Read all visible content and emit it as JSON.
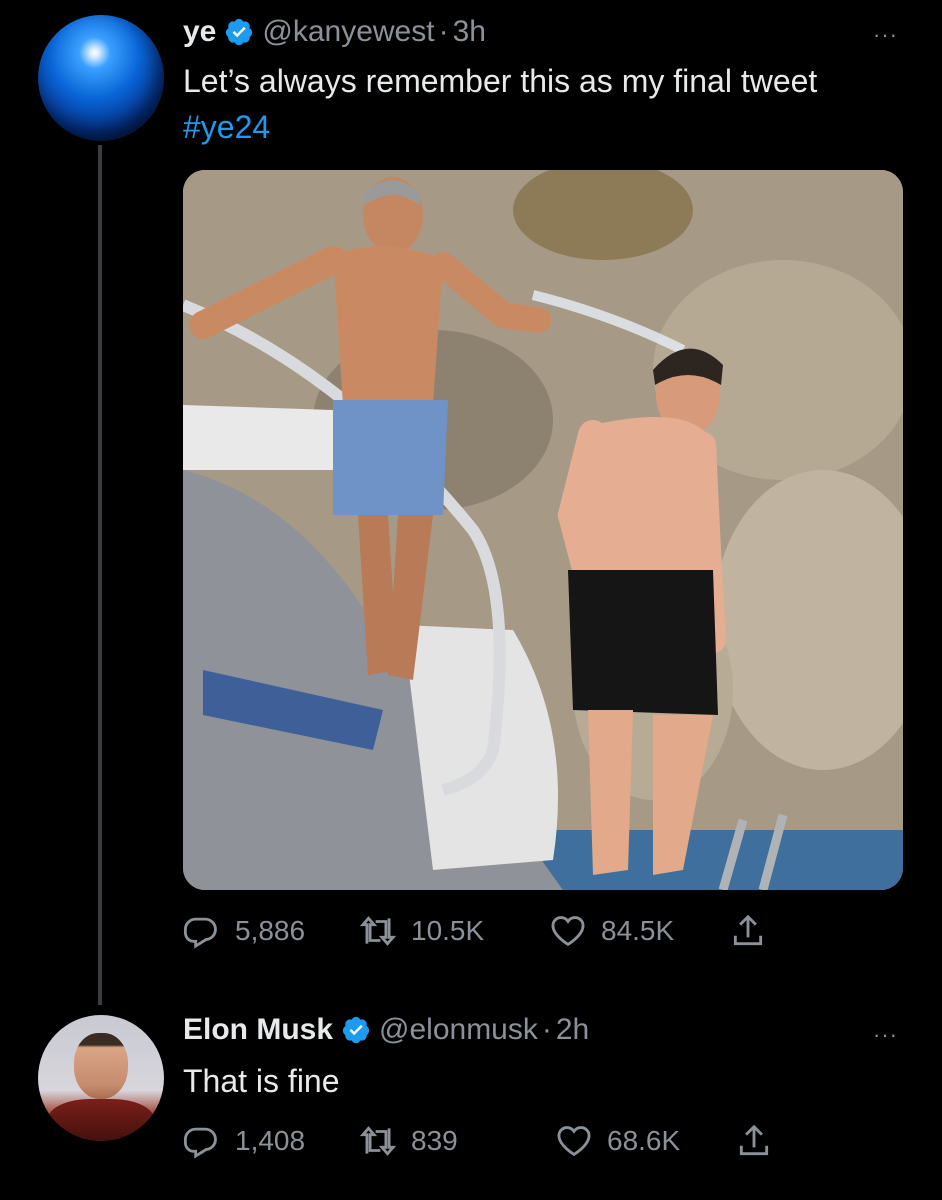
{
  "tweets": [
    {
      "name": "ye",
      "handle": "@kanyewest",
      "separator": "·",
      "time": "3h",
      "text_main": "Let’s always remember this as my final tweet ",
      "hashtag": "#ye24",
      "more_label": "···",
      "has_media": true,
      "stats": {
        "replies": "5,886",
        "retweets": "10.5K",
        "likes": "84.5K"
      },
      "icons": {
        "reply": "reply-icon",
        "retweet": "retweet-icon",
        "like": "heart-icon",
        "share": "share-icon",
        "verified": "verified-badge-icon"
      }
    },
    {
      "name": "Elon Musk",
      "handle": "@elonmusk",
      "separator": "·",
      "time": "2h",
      "text_main": "That is fine",
      "more_label": "···",
      "stats": {
        "replies": "1,408",
        "retweets": "839",
        "likes": "68.6K"
      }
    }
  ],
  "colors": {
    "background": "#000000",
    "text": "#e7e9ea",
    "secondary": "#8b9198",
    "accent": "#1d9bf0",
    "verified": "#1d9bf0"
  }
}
